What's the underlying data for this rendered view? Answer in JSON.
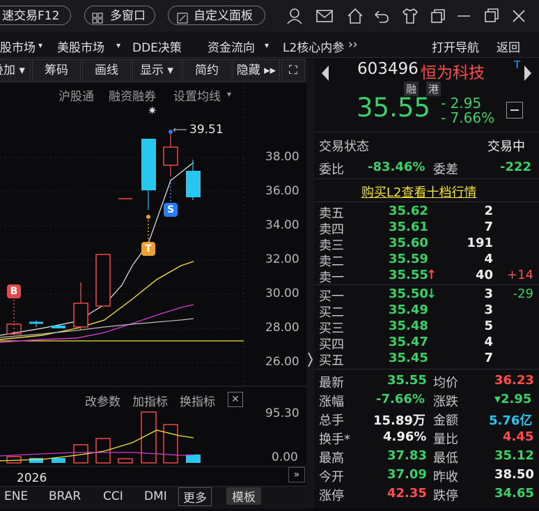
{
  "topbar": {
    "fast_trade": "速交易F12",
    "multi_window": "多窗口",
    "custom_panel": "自定义面板"
  },
  "menubar": {
    "items": [
      "股市场",
      "美股市场",
      "DDE决策",
      "资金流向",
      "L2核心内参",
      "打开导航",
      "返回"
    ]
  },
  "toolbar": {
    "items": [
      "叠加",
      "筹码",
      "画线",
      "显示",
      "简约",
      "隐藏"
    ]
  },
  "chart_header": {
    "links": [
      "沪股通",
      "融资融券",
      "设置均线"
    ]
  },
  "chart": {
    "high_label": "39.51",
    "marker_b": "B",
    "marker_s": "S",
    "marker_t": "T",
    "y_ticks": [
      "38.00",
      "36.00",
      "34.00",
      "32.00",
      "30.00",
      "28.00",
      "26.00"
    ],
    "year": "2026"
  },
  "indicator": {
    "actions": [
      "改参数",
      "加指标",
      "换指标"
    ],
    "y_ticks": [
      "95.30",
      "0.00"
    ]
  },
  "bottom_tabs": [
    "ENE",
    "BRAR",
    "CCI",
    "DMI",
    "更多",
    "模板"
  ],
  "stock": {
    "code": "603496",
    "name": "恒为科技",
    "flag": "T",
    "badge1": "融",
    "badge2": "港",
    "price": "35.55",
    "change": "- 2.95",
    "change_pct": "- 7.66%"
  },
  "status": {
    "label": "交易状态",
    "value": "交易中",
    "wb_label": "委比",
    "wb_value": "-83.46%",
    "wc_label": "委差",
    "wc_value": "-222",
    "l2_link": "购买L2查看十档行情"
  },
  "asks": [
    {
      "name": "卖五",
      "price": "35.62",
      "vol": "2",
      "delta": ""
    },
    {
      "name": "卖四",
      "price": "35.61",
      "vol": "7",
      "delta": ""
    },
    {
      "name": "卖三",
      "price": "35.60",
      "vol": "191",
      "delta": ""
    },
    {
      "name": "卖二",
      "price": "35.59",
      "vol": "4",
      "delta": ""
    },
    {
      "name": "卖一",
      "price": "35.55",
      "vol": "40",
      "delta": "+14"
    }
  ],
  "bids": [
    {
      "name": "买一",
      "price": "35.50",
      "vol": "3",
      "delta": "-29"
    },
    {
      "name": "买二",
      "price": "35.49",
      "vol": "3",
      "delta": ""
    },
    {
      "name": "买三",
      "price": "35.48",
      "vol": "5",
      "delta": ""
    },
    {
      "name": "买四",
      "price": "35.47",
      "vol": "4",
      "delta": ""
    },
    {
      "name": "买五",
      "price": "35.45",
      "vol": "7",
      "delta": ""
    }
  ],
  "stats": [
    {
      "l1": "最新",
      "v1": "35.55",
      "l2": "均价",
      "v2": "36.23"
    },
    {
      "l1": "涨幅",
      "v1": "-7.66%",
      "l2": "涨跌",
      "v2": "▾2.95"
    },
    {
      "l1": "总手",
      "v1": "15.89万",
      "l2": "金额",
      "v2": "5.76亿"
    },
    {
      "l1": "换手*",
      "v1": "4.96%",
      "l2": "量比",
      "v2": "4.45"
    },
    {
      "l1": "最高",
      "v1": "37.83",
      "l2": "最低",
      "v2": "35.12"
    },
    {
      "l1": "今开",
      "v1": "37.09",
      "l2": "昨收",
      "v2": "38.50"
    },
    {
      "l1": "涨停",
      "v1": "42.35",
      "l2": "跌停",
      "v2": "34.65"
    }
  ],
  "colors": {
    "up": "#ff4d4d",
    "down": "#3ad06a",
    "cyan": "#27c7f2",
    "yellow": "#f2e23a",
    "magenta": "#d23ad2",
    "background": "#0b0b0e"
  }
}
